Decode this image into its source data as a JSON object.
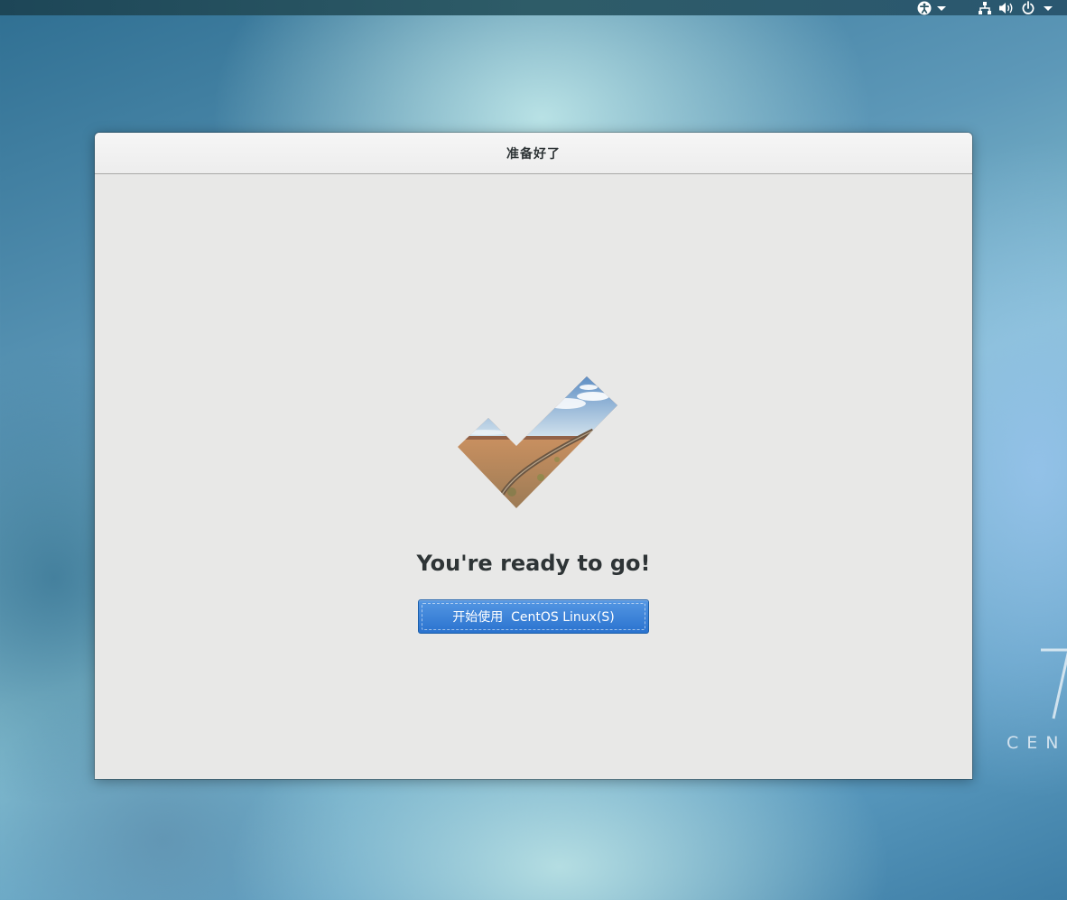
{
  "top_bar": {
    "icons": [
      "accessibility-icon",
      "chevron-down-icon",
      "network-icon",
      "volume-icon",
      "power-icon",
      "chevron-down-icon"
    ]
  },
  "window": {
    "title": "准备好了"
  },
  "main": {
    "image_icon": "checkmark-landscape-icon",
    "heading": "You're ready to go!",
    "start_button_label": "开始使用  CentOS Linux(S)"
  },
  "desktop": {
    "logo_text": "CEN"
  },
  "colors": {
    "button": "#2f78d2",
    "window_bg": "#e8e8e7",
    "text": "#2e3436"
  }
}
